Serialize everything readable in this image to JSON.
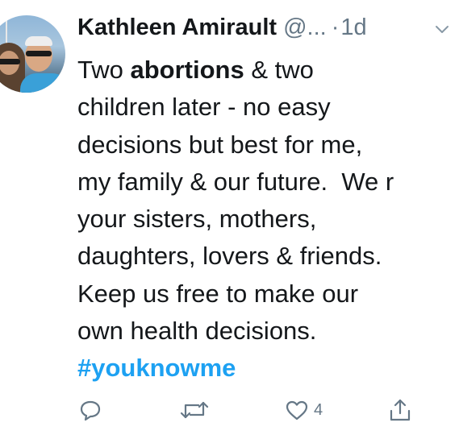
{
  "tweet": {
    "author_name": "Kathleen Amirault",
    "handle": "@...",
    "separator": "·",
    "time": "1d",
    "text_lines": [
      {
        "pre": "Two ",
        "bold": "abortions",
        "post": " & two"
      },
      {
        "pre": "children later - no easy",
        "bold": "",
        "post": ""
      },
      {
        "pre": "decisions but best for me,",
        "bold": "",
        "post": ""
      },
      {
        "pre": "my family & our future.  We r",
        "bold": "",
        "post": ""
      },
      {
        "pre": "your sisters, mothers,",
        "bold": "",
        "post": ""
      },
      {
        "pre": "daughters, lovers & friends.",
        "bold": "",
        "post": ""
      },
      {
        "pre": "Keep us free to make our",
        "bold": "",
        "post": ""
      },
      {
        "pre": "own health decisions.",
        "bold": "",
        "post": ""
      }
    ],
    "hashtag": "#youknowme"
  },
  "actions": {
    "reply": {
      "icon": "reply-icon",
      "count": ""
    },
    "retweet": {
      "icon": "retweet-icon",
      "count": ""
    },
    "like": {
      "icon": "heart-icon",
      "count": "4"
    },
    "share": {
      "icon": "share-icon",
      "count": ""
    }
  },
  "colors": {
    "text": "#14171a",
    "secondary": "#657786",
    "link": "#1da1f2"
  }
}
